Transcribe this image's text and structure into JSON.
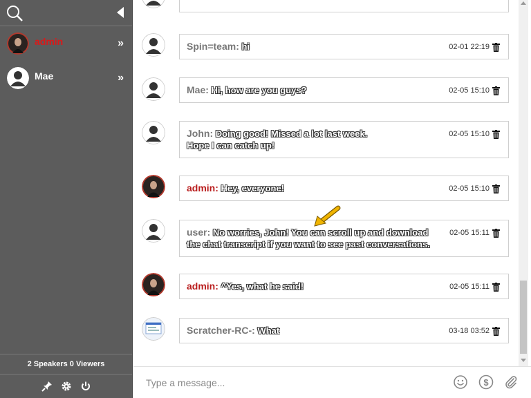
{
  "sidebar": {
    "users": [
      {
        "name": "admin",
        "highlight": true
      },
      {
        "name": "Mae",
        "highlight": false
      }
    ],
    "stats": {
      "speakers_count": "2",
      "speakers_label": "Speakers",
      "viewers_count": "0",
      "viewers_label": "Viewers"
    }
  },
  "messages": [
    {
      "name": "Spin=team:",
      "text": "hi",
      "time": "02-01 22:19",
      "avatar": "default"
    },
    {
      "name": "Mae:",
      "text": "Hi, how are you guys?",
      "time": "02-05 15:10",
      "avatar": "default"
    },
    {
      "name": "John:",
      "text": "Doing good! Missed a lot last week.",
      "text2": "Hope I can catch up!",
      "time": "02-05 15:10",
      "avatar": "default"
    },
    {
      "name": "admin:",
      "text": "Hey, everyone!",
      "time": "02-05 15:10",
      "avatar": "photo"
    },
    {
      "name": "user:",
      "text": "No worries, John! You can scroll up and download",
      "text2": "the chat transcript if you want to see past conversations.",
      "time": "02-05 15:11",
      "avatar": "default"
    },
    {
      "name": "admin:",
      "text": "^Yes, what he said!",
      "time": "02-05 15:11",
      "avatar": "photo"
    },
    {
      "name": "Scratcher-RC-:",
      "text": "What",
      "time": "03-18 03:52",
      "avatar": "screenshot"
    }
  ],
  "input": {
    "placeholder": "Type a message..."
  },
  "colors": {
    "sidebar_bg": "#5c5c5c",
    "admin_red": "#b91c1c",
    "arrow": "#f0b400"
  }
}
